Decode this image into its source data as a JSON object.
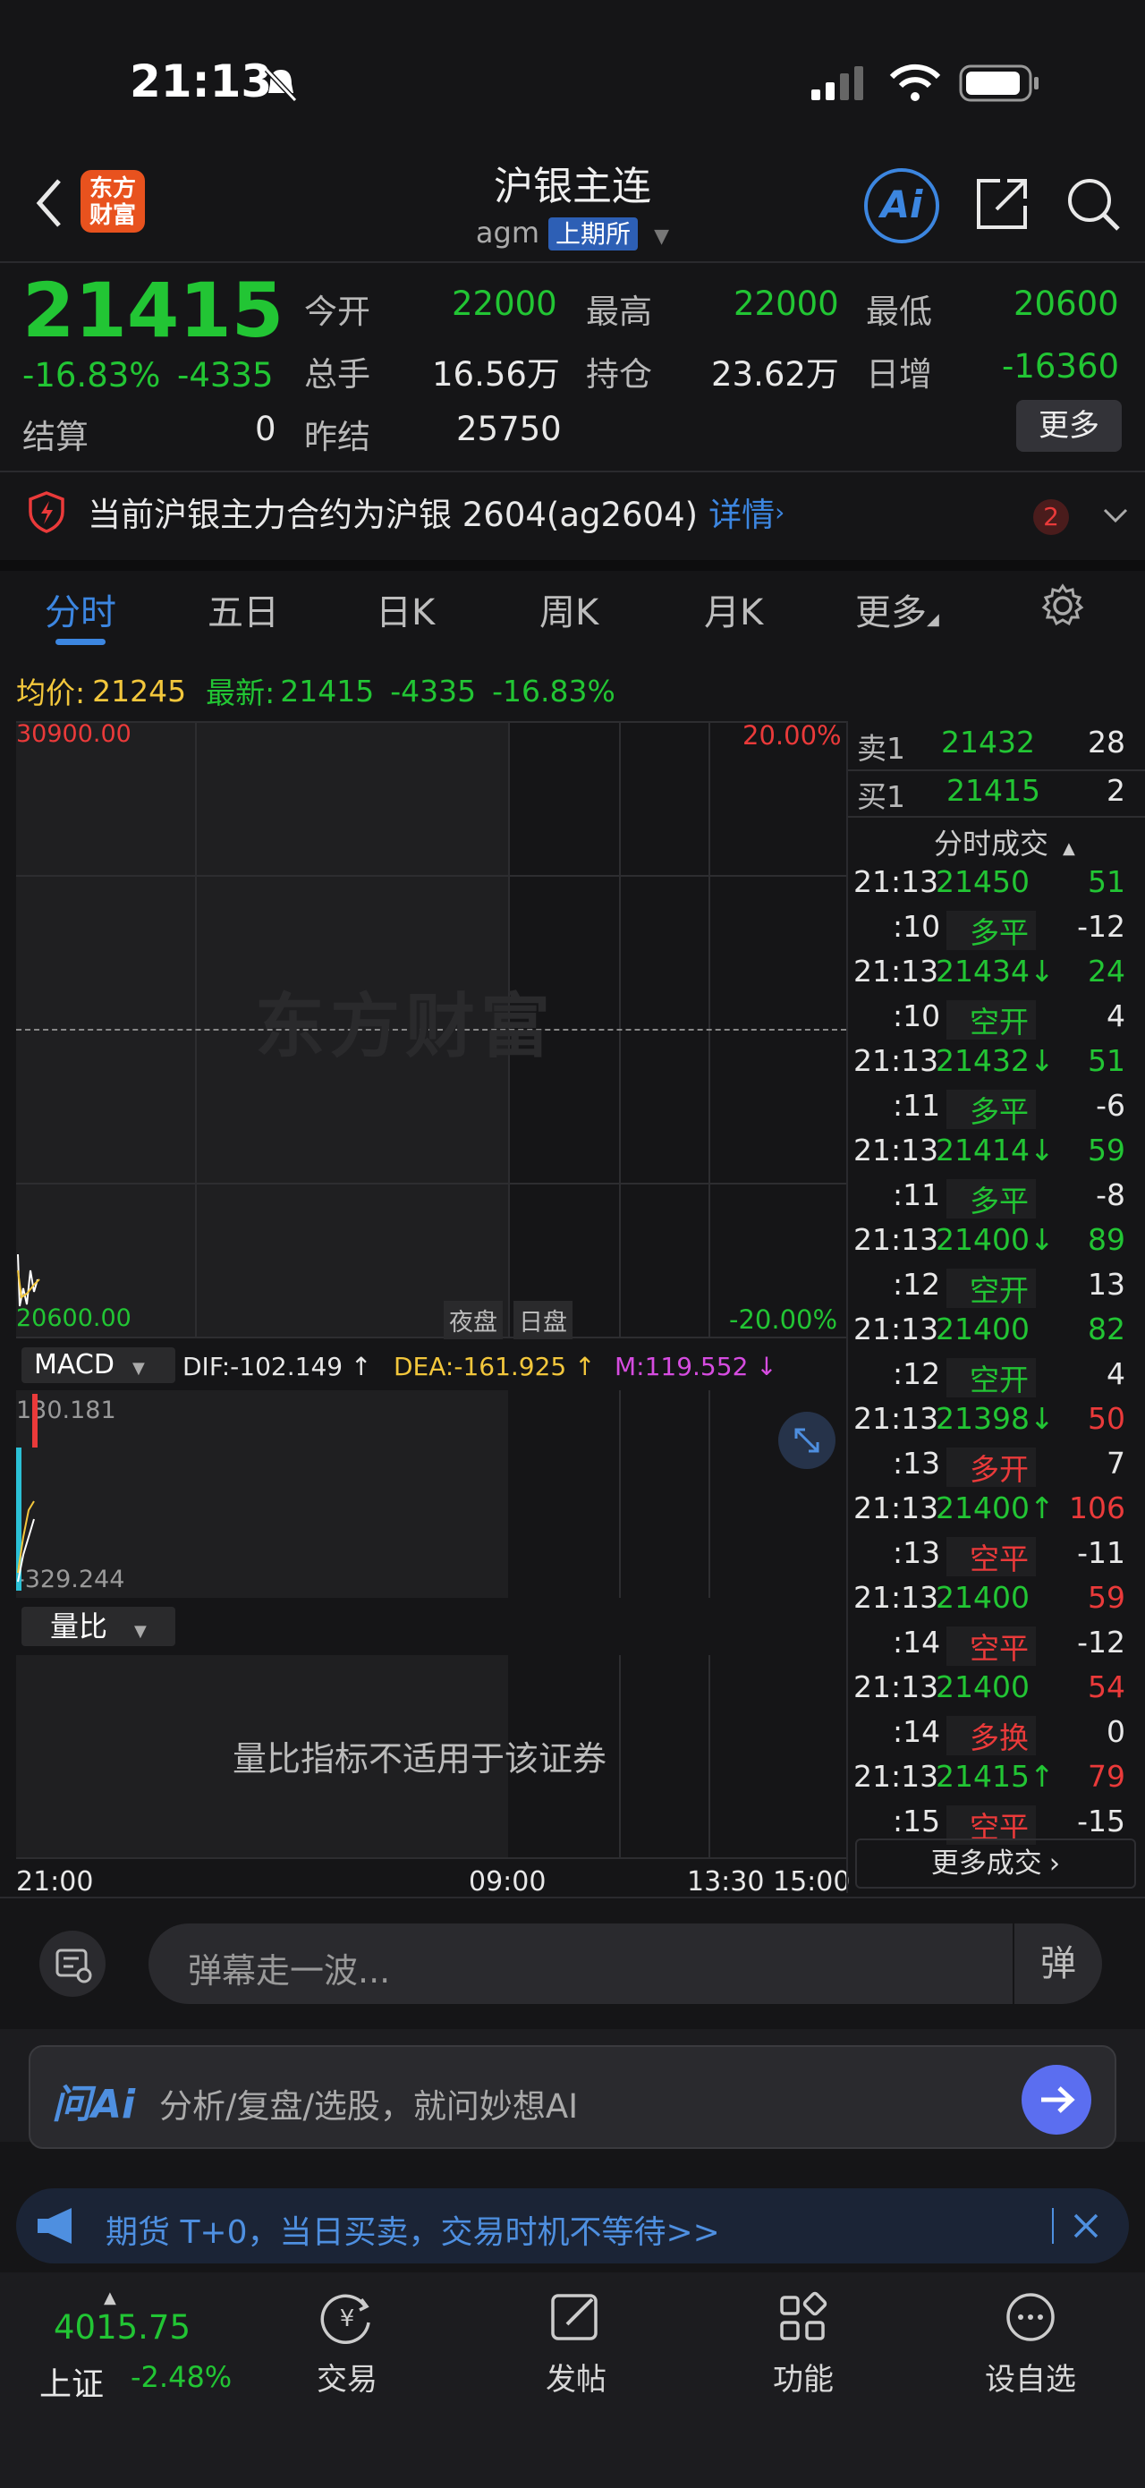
{
  "status": {
    "time": "21:13"
  },
  "header": {
    "title": "沪银主连",
    "code": "agm",
    "exchange": "上期所",
    "logo_line1": "东方",
    "logo_line2": "财富",
    "ai_label": "Ai"
  },
  "quote": {
    "price": "21415",
    "change_pct": "-16.83%",
    "change": "-4335",
    "settle_label": "结算",
    "settle": "0",
    "open_label": "今开",
    "open": "22000",
    "high_label": "最高",
    "high": "22000",
    "low_label": "最低",
    "low": "20600",
    "vol_label": "总手",
    "vol": "16.56万",
    "oi_label": "持仓",
    "oi": "23.62万",
    "dayinc_label": "日增",
    "dayinc": "-16360",
    "prev_label": "昨结",
    "prev": "25750",
    "more_label": "更多"
  },
  "notice": {
    "text": "当前沪银主力合约为沪银 2604(ag2604)",
    "link": "详情",
    "badge": "2"
  },
  "tabs": [
    "分时",
    "五日",
    "日K",
    "周K",
    "月K",
    "更多"
  ],
  "chart_info": {
    "avg_label": "均价:",
    "avg": "21245",
    "last_label": "最新:",
    "last": "21415",
    "chg": "-4335",
    "pct": "-16.83%"
  },
  "chart": {
    "top_left": "30900.00",
    "top_right": "20.00%",
    "bot_left": "20600.00",
    "bot_right": "-20.00%",
    "watermark": "东方财富",
    "session_night": "夜盘",
    "session_day": "日盘",
    "macd_label": "MACD",
    "dif": "DIF:-102.149 ↑",
    "dea": "DEA:-161.925 ↑",
    "m": "M:119.552 ↓",
    "macd_top": "130.181",
    "macd_bot": "-329.244",
    "volratio_label": "量比",
    "volratio_msg": "量比指标不适用于该证券",
    "time_labels": [
      "21:00",
      "09:00",
      "13:30",
      "15:00"
    ]
  },
  "orderbook": {
    "sell_label": "卖1",
    "sell_price": "21432",
    "sell_vol": "28",
    "buy_label": "买1",
    "buy_price": "21415",
    "buy_vol": "2",
    "trades_title": "分时成交",
    "more_trades": "更多成交"
  },
  "trades": [
    {
      "t": "21:13",
      "p": "21450",
      "v": "51",
      "pc": "g",
      "vc": "g"
    },
    {
      "t": ":10",
      "p": "多平",
      "v": "-12",
      "pc": "g",
      "vc": "w"
    },
    {
      "t": "21:13",
      "p": "21434↓",
      "v": "24",
      "pc": "g",
      "vc": "g"
    },
    {
      "t": ":10",
      "p": "空开",
      "v": "4",
      "pc": "g",
      "vc": "w"
    },
    {
      "t": "21:13",
      "p": "21432↓",
      "v": "51",
      "pc": "g",
      "vc": "g"
    },
    {
      "t": ":11",
      "p": "多平",
      "v": "-6",
      "pc": "g",
      "vc": "w"
    },
    {
      "t": "21:13",
      "p": "21414↓",
      "v": "59",
      "pc": "g",
      "vc": "g"
    },
    {
      "t": ":11",
      "p": "多平",
      "v": "-8",
      "pc": "g",
      "vc": "w"
    },
    {
      "t": "21:13",
      "p": "21400↓",
      "v": "89",
      "pc": "g",
      "vc": "g"
    },
    {
      "t": ":12",
      "p": "空开",
      "v": "13",
      "pc": "g",
      "vc": "w"
    },
    {
      "t": "21:13",
      "p": "21400",
      "v": "82",
      "pc": "g",
      "vc": "g"
    },
    {
      "t": ":12",
      "p": "空开",
      "v": "4",
      "pc": "g",
      "vc": "w"
    },
    {
      "t": "21:13",
      "p": "21398↓",
      "v": "50",
      "pc": "g",
      "vc": "r"
    },
    {
      "t": ":13",
      "p": "多开",
      "v": "7",
      "pc": "r",
      "vc": "w"
    },
    {
      "t": "21:13",
      "p": "21400↑",
      "v": "106",
      "pc": "g",
      "vc": "r"
    },
    {
      "t": ":13",
      "p": "空平",
      "v": "-11",
      "pc": "r",
      "vc": "w"
    },
    {
      "t": "21:13",
      "p": "21400",
      "v": "59",
      "pc": "g",
      "vc": "r"
    },
    {
      "t": ":14",
      "p": "空平",
      "v": "-12",
      "pc": "r",
      "vc": "w"
    },
    {
      "t": "21:13",
      "p": "21400",
      "v": "54",
      "pc": "g",
      "vc": "r"
    },
    {
      "t": ":14",
      "p": "多换",
      "v": "0",
      "pc": "r",
      "vc": "w"
    },
    {
      "t": "21:13",
      "p": "21415↑",
      "v": "79",
      "pc": "g",
      "vc": "r"
    },
    {
      "t": ":15",
      "p": "空平",
      "v": "-15",
      "pc": "r",
      "vc": "w"
    }
  ],
  "danmu": {
    "placeholder": "弹幕走一波...",
    "btn": "弹"
  },
  "ai_bar": {
    "brand": "问Ai",
    "placeholder": "分析/复盘/选股，就问妙想AI"
  },
  "promo": {
    "text": "期货 T+0，当日买卖，交易时机不等待>>"
  },
  "nav": {
    "index_value": "4015.75",
    "index_name": "上证",
    "index_pct": "-2.48%",
    "items": [
      "交易",
      "发帖",
      "功能",
      "设自选"
    ]
  },
  "colors": {
    "green": "#22c534",
    "red": "#ea3a3a",
    "accent": "#2e7bd6"
  }
}
